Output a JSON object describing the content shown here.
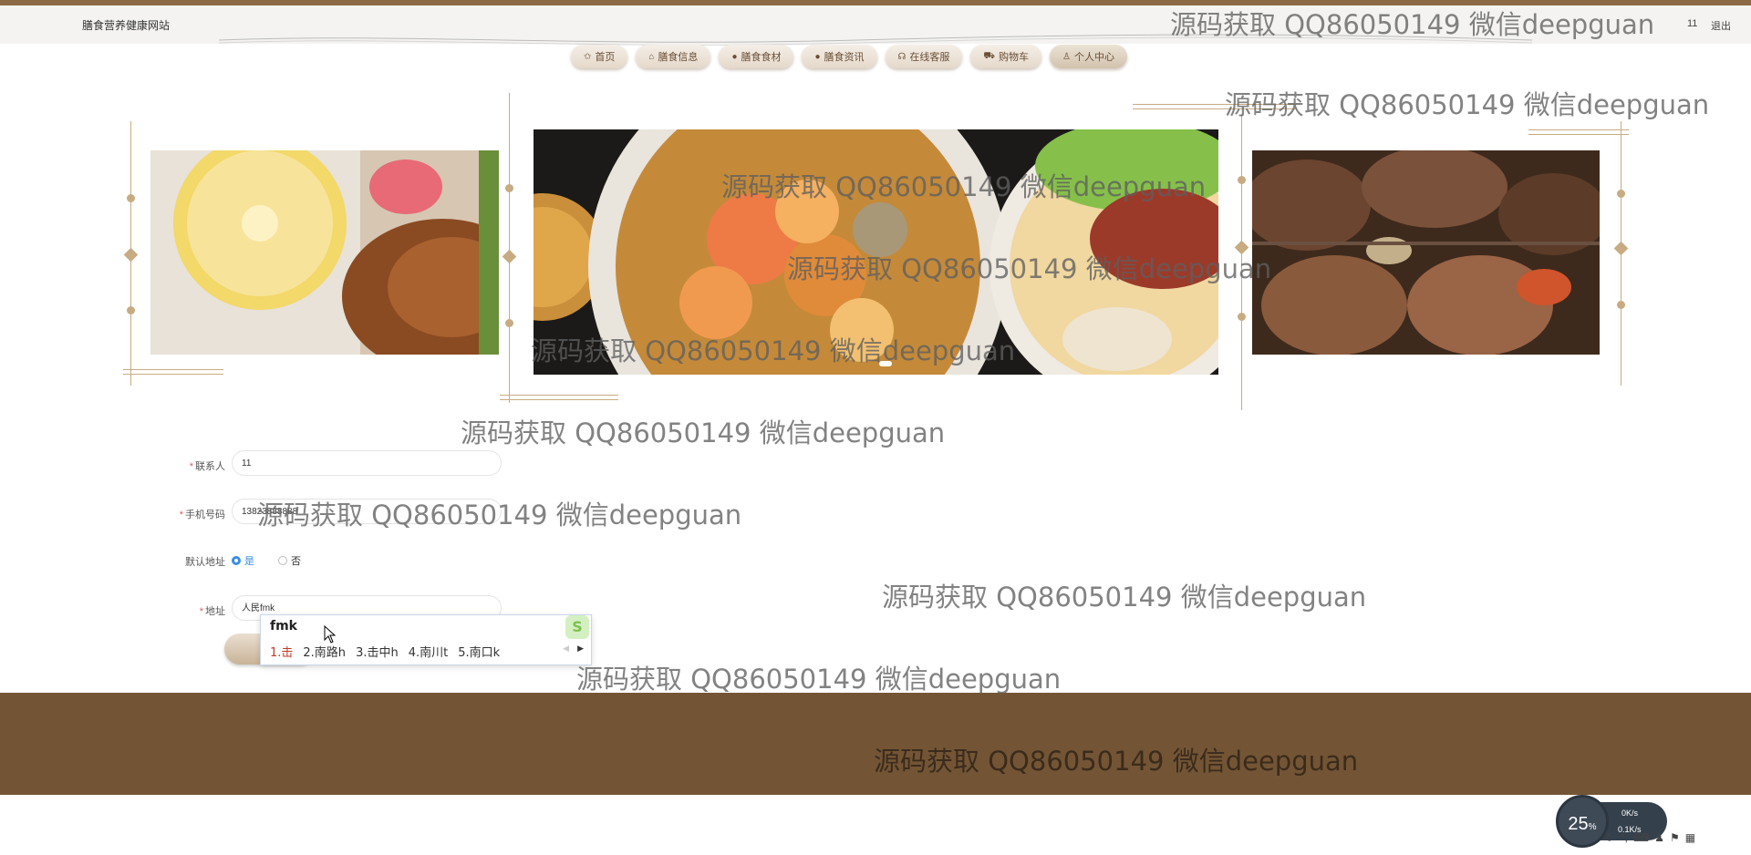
{
  "header": {
    "site_title": "膳食营养健康网站",
    "user_name": "11",
    "logout_label": "退出"
  },
  "nav": {
    "items": [
      {
        "icon": "home-icon",
        "glyph": "✩",
        "label": "首页"
      },
      {
        "icon": "lock-icon",
        "glyph": "⌂",
        "label": "膳食信息"
      },
      {
        "icon": "info-icon",
        "glyph": "●",
        "label": "膳食食材"
      },
      {
        "icon": "question-icon",
        "glyph": "●",
        "label": "膳食资讯"
      },
      {
        "icon": "headset-icon",
        "glyph": "☊",
        "label": "在线客服"
      },
      {
        "icon": "cart-icon",
        "glyph": "⛟",
        "label": "购物车"
      },
      {
        "icon": "person-icon",
        "glyph": "♙",
        "label": "个人中心"
      }
    ],
    "active_index": 6
  },
  "form": {
    "contact": {
      "label": "联系人",
      "required": true,
      "value": "11"
    },
    "phone": {
      "label": "手机号码",
      "required": true,
      "value": "13823888888"
    },
    "default_address": {
      "label": "默认地址",
      "options": [
        "是",
        "否"
      ],
      "selected": "是"
    },
    "address": {
      "label": "地址",
      "required": true,
      "value": "人民fmk"
    }
  },
  "ime": {
    "composition": "fmk",
    "candidates": [
      "1.击",
      "2.南路h",
      "3.击中h",
      "4.南川t",
      "5.南口k"
    ],
    "logo": "S"
  },
  "watermark_text": "源码获取 QQ86050149 微信deepguan",
  "system": {
    "cpu_percent": "25",
    "percent_sign": "%",
    "upload": "0",
    "download": "0.1",
    "unit": "K/s"
  },
  "colors": {
    "brand_brown": "#8b6a45",
    "footer": "#735535",
    "accent_gold": "#c8ab82",
    "radio_on": "#3a8ee6"
  }
}
